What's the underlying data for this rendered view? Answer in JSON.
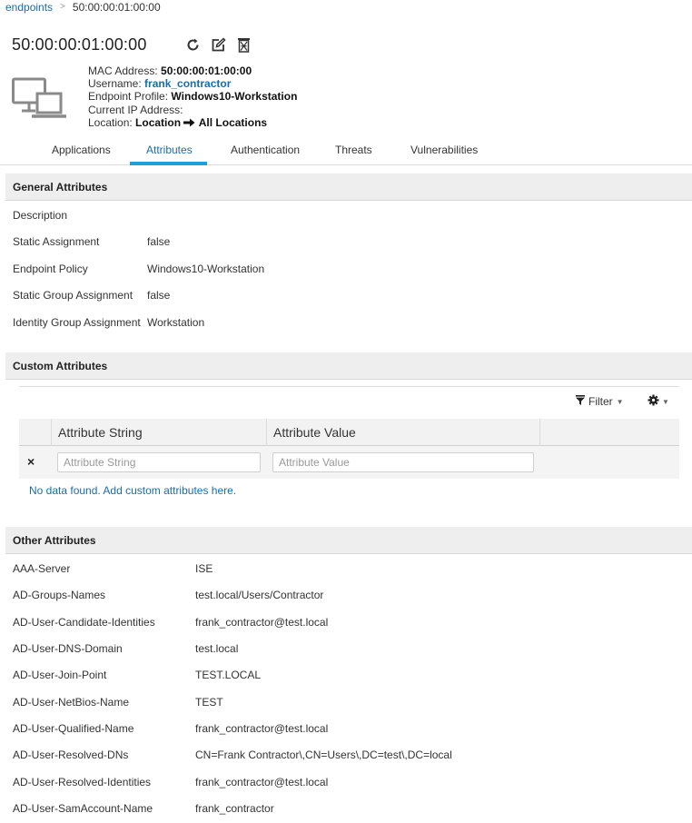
{
  "breadcrumb": {
    "link": "endpoints",
    "separator": ">",
    "current": "50:00:00:01:00:00"
  },
  "header": {
    "title": "50:00:00:01:00:00",
    "actions": {
      "refresh_icon": "refresh-icon",
      "edit_icon": "edit-icon",
      "delete_icon": "trash-icon"
    }
  },
  "endpoint": {
    "icon": "computer-icon",
    "mac_label": "MAC Address:",
    "mac_value": "50:00:00:01:00:00",
    "username_label": "Username:",
    "username_value": "frank_contractor",
    "profile_label": "Endpoint Profile:",
    "profile_value": "Windows10-Workstation",
    "ip_label": "Current IP Address:",
    "ip_value": "",
    "location_label": "Location:",
    "location_from": "Location",
    "location_to": "All Locations"
  },
  "tabs": [
    {
      "label": "Applications",
      "active": false
    },
    {
      "label": "Attributes",
      "active": true
    },
    {
      "label": "Authentication",
      "active": false
    },
    {
      "label": "Threats",
      "active": false
    },
    {
      "label": "Vulnerabilities",
      "active": false
    }
  ],
  "general": {
    "title": "General Attributes",
    "rows": [
      {
        "key": "Description",
        "value": ""
      },
      {
        "key": "Static Assignment",
        "value": "false"
      },
      {
        "key": "Endpoint Policy",
        "value": "Windows10-Workstation"
      },
      {
        "key": "Static Group Assignment",
        "value": "false"
      },
      {
        "key": "Identity Group Assignment",
        "value": "Workstation"
      }
    ]
  },
  "custom": {
    "title": "Custom Attributes",
    "filter_label": "Filter",
    "columns": [
      "Attribute String",
      "Attribute Value"
    ],
    "remove_symbol": "×",
    "string_placeholder": "Attribute String",
    "value_placeholder": "Attribute Value",
    "empty_message": "No data found. Add custom attributes here."
  },
  "other": {
    "title": "Other Attributes",
    "rows": [
      {
        "key": "AAA-Server",
        "value": "ISE"
      },
      {
        "key": "AD-Groups-Names",
        "value": "test.local/Users/Contractor"
      },
      {
        "key": "AD-User-Candidate-Identities",
        "value": "frank_contractor@test.local"
      },
      {
        "key": "AD-User-DNS-Domain",
        "value": "test.local"
      },
      {
        "key": "AD-User-Join-Point",
        "value": "TEST.LOCAL"
      },
      {
        "key": "AD-User-NetBios-Name",
        "value": "TEST"
      },
      {
        "key": "AD-User-Qualified-Name",
        "value": "frank_contractor@test.local"
      },
      {
        "key": "AD-User-Resolved-DNs",
        "value": "CN=Frank Contractor\\,CN=Users\\,DC=test\\,DC=local"
      },
      {
        "key": "AD-User-Resolved-Identities",
        "value": "frank_contractor@test.local"
      },
      {
        "key": "AD-User-SamAccount-Name",
        "value": "frank_contractor"
      }
    ]
  }
}
